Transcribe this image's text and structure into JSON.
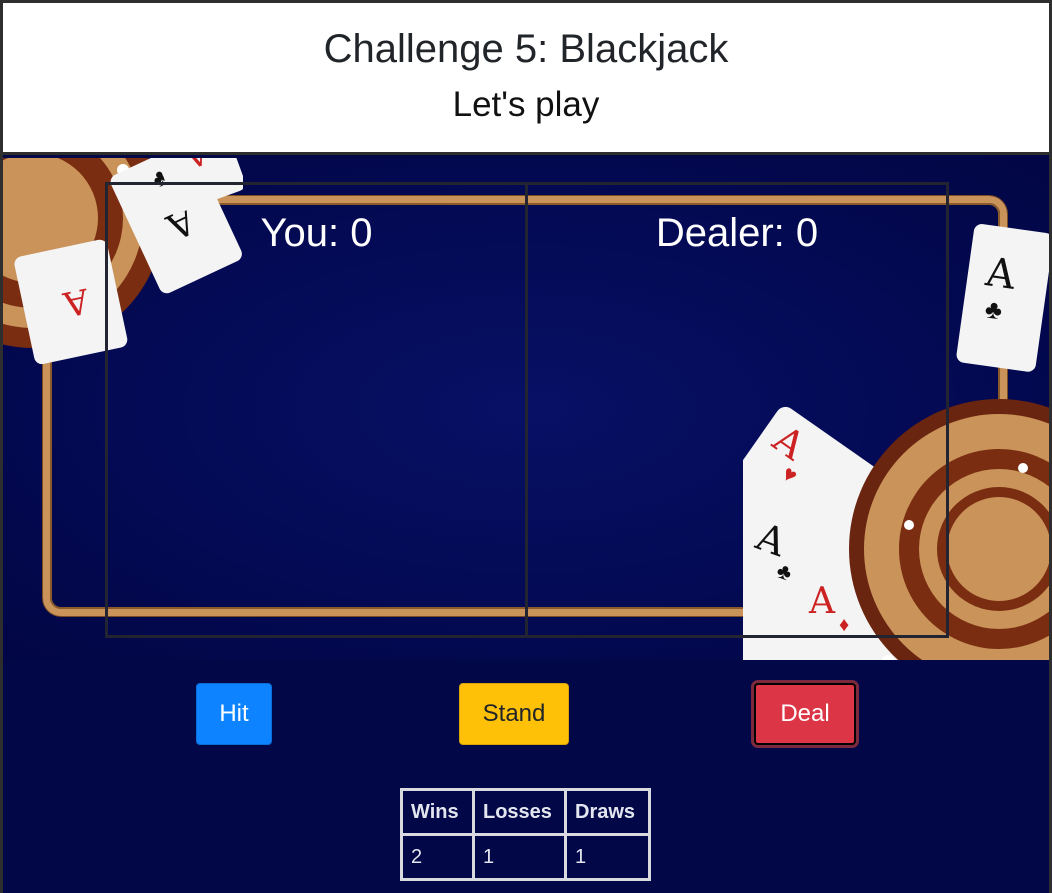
{
  "header": {
    "title": "Challenge 5: Blackjack",
    "subtitle": "Let's play"
  },
  "players": {
    "you_label": "You: 0",
    "dealer_label": "Dealer: 0"
  },
  "controls": {
    "hit_label": "Hit",
    "stand_label": "Stand",
    "deal_label": "Deal"
  },
  "scoreboard": {
    "headers": [
      "Wins",
      "Losses",
      "Draws"
    ],
    "values": [
      "2",
      "1",
      "1"
    ]
  },
  "decor": {
    "cards_top_left": [
      "A",
      "A",
      "A"
    ],
    "cards_right": [
      "A",
      "A",
      "A",
      "A"
    ]
  },
  "colors": {
    "felt": "#020847",
    "rail": "#c9935a",
    "hit": "#0d83ff",
    "stand": "#ffc107",
    "deal": "#dc3545"
  }
}
